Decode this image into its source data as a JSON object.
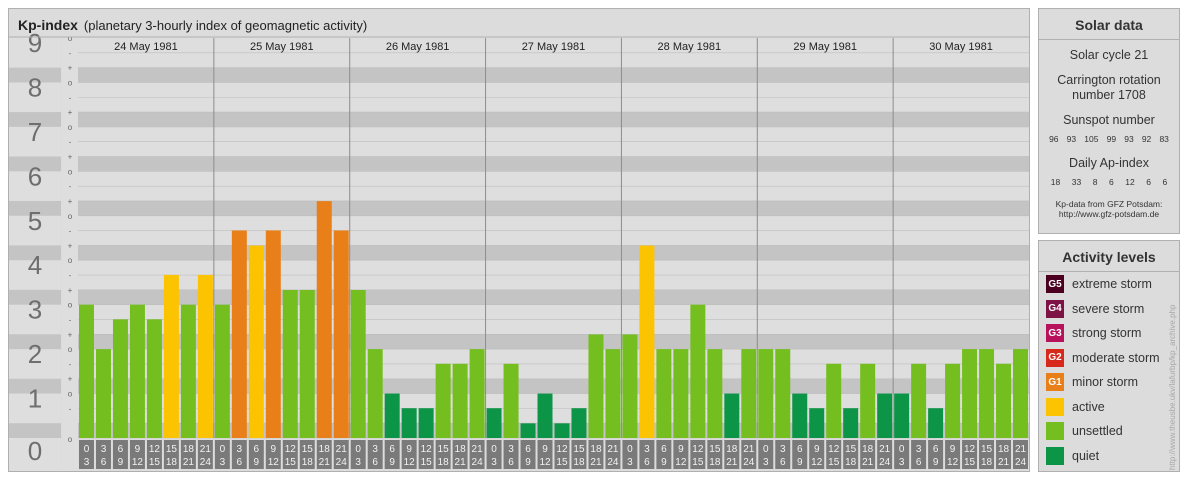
{
  "header": {
    "title": "Kp-index",
    "subtitle": "(planetary 3-hourly index of geomagnetic activity)"
  },
  "colors": {
    "quiet": "#0c9447",
    "unsettled": "#74be1f",
    "active": "#fcc400",
    "minor_storm": "#e87f18",
    "moderate_storm": "#d6281b",
    "strong_storm": "#b8125c",
    "severe_storm": "#7d1244",
    "extreme_storm": "#4c0020",
    "band_dark": "#c4c4c4",
    "band_light": "#dedede",
    "time_cell": "#7a7a7a"
  },
  "chart_data": {
    "type": "bar",
    "y_ticks": [
      "0",
      "1",
      "2",
      "3",
      "4",
      "5",
      "6",
      "7",
      "8",
      "9"
    ],
    "minor_ticks": [
      "o",
      "+",
      "-"
    ],
    "ylim": [
      0,
      9
    ],
    "days": [
      "24 May 1981",
      "25 May 1981",
      "26 May 1981",
      "27 May 1981",
      "28 May 1981",
      "29 May 1981",
      "30 May 1981"
    ],
    "interval_start": [
      "0",
      "3",
      "6",
      "9",
      "12",
      "15",
      "18",
      "21"
    ],
    "interval_end": [
      "3",
      "6",
      "9",
      "12",
      "15",
      "18",
      "21",
      "24"
    ],
    "kp_values": [
      [
        3.0,
        2.0,
        2.67,
        3.0,
        2.67,
        3.67,
        3.0,
        3.67
      ],
      [
        3.0,
        4.67,
        4.33,
        4.67,
        3.33,
        3.33,
        5.33,
        4.67
      ],
      [
        3.33,
        2.0,
        1.0,
        0.67,
        0.67,
        1.67,
        1.67,
        2.0
      ],
      [
        0.67,
        1.67,
        0.33,
        1.0,
        0.33,
        0.67,
        2.33,
        2.0
      ],
      [
        2.33,
        4.33,
        2.0,
        2.0,
        3.0,
        2.0,
        1.0,
        2.0
      ],
      [
        2.0,
        2.0,
        1.0,
        0.67,
        1.67,
        0.67,
        1.67,
        1.0
      ],
      [
        1.0,
        1.67,
        0.67,
        1.67,
        2.0,
        2.0,
        1.67,
        2.0
      ]
    ]
  },
  "solar": {
    "title": "Solar data",
    "cycle": "Solar cycle 21",
    "carrington_line1": "Carrington rotation",
    "carrington_line2": "number 1708",
    "sunspot_title": "Sunspot number",
    "sunspot_values": [
      "96",
      "93",
      "105",
      "99",
      "93",
      "92",
      "83"
    ],
    "ap_title": "Daily Ap-index",
    "ap_values": [
      "18",
      "33",
      "8",
      "6",
      "12",
      "6",
      "6"
    ],
    "source_line1": "Kp-data from GFZ Potsdam:",
    "source_line2": "http://www.gfz-potsdam.de"
  },
  "levels": {
    "title": "Activity levels",
    "items": [
      {
        "code": "G5",
        "label": "extreme storm",
        "color": "#4c0020"
      },
      {
        "code": "G4",
        "label": "severe storm",
        "color": "#7d1244"
      },
      {
        "code": "G3",
        "label": "strong storm",
        "color": "#b8125c"
      },
      {
        "code": "G2",
        "label": "moderate storm",
        "color": "#d6281b"
      },
      {
        "code": "G1",
        "label": "minor storm",
        "color": "#e87f18"
      },
      {
        "code": "",
        "label": "active",
        "color": "#fcc400"
      },
      {
        "code": "",
        "label": "unsettled",
        "color": "#74be1f"
      },
      {
        "code": "",
        "label": "quiet",
        "color": "#0c9447"
      }
    ]
  },
  "credit": "http://www.theusbe.ukv/lafurbp/kp_archive.php"
}
